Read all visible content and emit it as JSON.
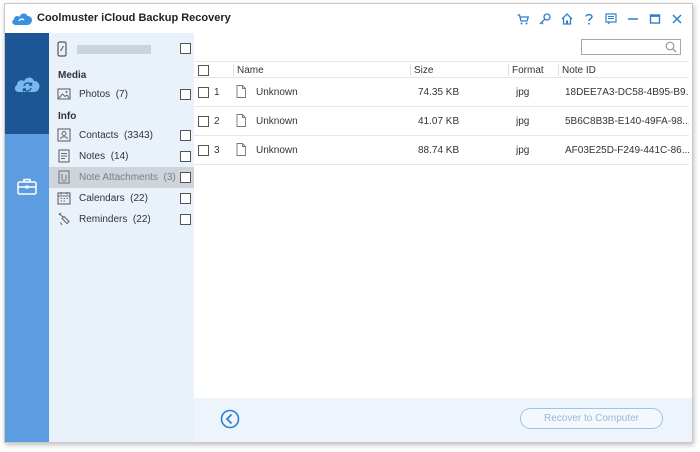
{
  "window": {
    "title": "Coolmuster iCloud Backup Recovery",
    "toolbar_icons": [
      "cart-icon",
      "key-icon",
      "home-icon",
      "help-icon",
      "feedback-icon",
      "minimize-icon",
      "maximize-icon",
      "close-icon"
    ]
  },
  "left_nav": {
    "items": [
      {
        "name": "icloud-recovery",
        "icon": "cloud-sync-icon",
        "active": true
      },
      {
        "name": "toolbox",
        "icon": "toolbox-icon",
        "active": false
      }
    ]
  },
  "sidebar": {
    "device_name": "",
    "sections": {
      "media": "Media",
      "info": "Info"
    },
    "items": [
      {
        "label": "Photos",
        "count": "(7)",
        "icon": "photo-icon",
        "checked": false
      },
      {
        "label": "Contacts",
        "count": "(3343)",
        "icon": "contacts-icon",
        "checked": false
      },
      {
        "label": "Notes",
        "count": "(14)",
        "icon": "notes-icon",
        "checked": false
      },
      {
        "label": "Note Attachments",
        "count": "(3)",
        "icon": "attachment-icon",
        "checked": false,
        "selected": true
      },
      {
        "label": "Calendars",
        "count": "(22)",
        "icon": "calendar-icon",
        "checked": false
      },
      {
        "label": "Reminders",
        "count": "(22)",
        "icon": "reminder-icon",
        "checked": false
      }
    ]
  },
  "search": {
    "value": "",
    "placeholder": ""
  },
  "table": {
    "columns": [
      "Name",
      "Size",
      "Format",
      "Note ID"
    ],
    "rows": [
      {
        "index": "1",
        "name": "Unknown",
        "size": "74.35 KB",
        "format": "jpg",
        "note_id": "18DEE7A3-DC58-4B95-B9..."
      },
      {
        "index": "2",
        "name": "Unknown",
        "size": "41.07 KB",
        "format": "jpg",
        "note_id": "5B6C8B3B-E140-49FA-98..."
      },
      {
        "index": "3",
        "name": "Unknown",
        "size": "88.74 KB",
        "format": "jpg",
        "note_id": "AF03E25D-F249-441C-86..."
      }
    ]
  },
  "footer": {
    "recover_label": "Recover to Computer"
  },
  "colors": {
    "nav_dark": "#1c5694",
    "nav_light": "#5b9de0",
    "sidebar_bg": "#e9f1fb",
    "accent": "#2f7fcf"
  }
}
